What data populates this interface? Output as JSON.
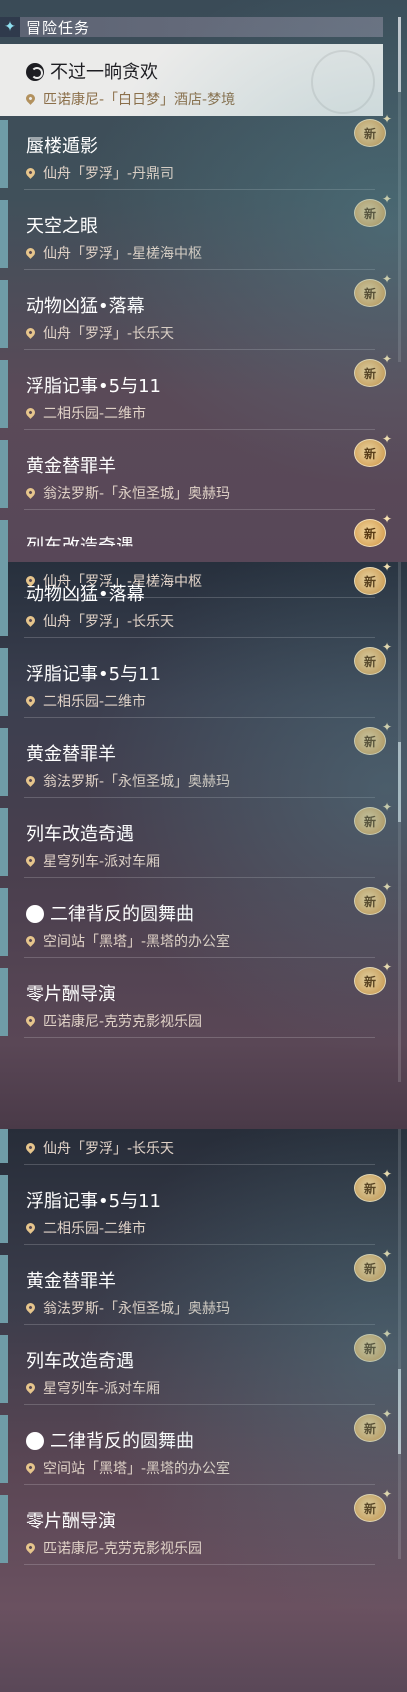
{
  "header": {
    "icon": "diamond-star-icon",
    "title": "冒险任务"
  },
  "badge_label": "新",
  "colors": {
    "accent_bar": "#6f9ca7",
    "badge": "#d9a65c",
    "selected_bg": "#ebebea",
    "location_text": "#e0d2c7"
  },
  "quests": [
    {
      "title": "不过一晌贪欢",
      "location": "匹诺康尼-「白日梦」酒店-梦境",
      "icon": "companion-quest-icon",
      "selected": true,
      "new": false
    },
    {
      "title": "蜃楼遁影",
      "location": "仙舟「罗浮」-丹鼎司",
      "new": true
    },
    {
      "title": "天空之眼",
      "location": "仙舟「罗浮」-星槎海中枢",
      "new": true
    },
    {
      "title": "动物凶猛•落幕",
      "location": "仙舟「罗浮」-长乐天",
      "new": true
    },
    {
      "title": "浮脂记事•5与11",
      "location": "二相乐园-二维市",
      "new": true
    },
    {
      "title": "黄金替罪羊",
      "location": "翁法罗斯-「永恒圣城」奥赫玛",
      "new": true
    },
    {
      "title": "列车改造奇遇",
      "location": "星穹列车-派对车厢",
      "new": true
    },
    {
      "title": "二律背反的圆舞曲",
      "location": "空间站「黑塔」-黑塔的办公室",
      "icon": "companion-quest-icon",
      "new": true
    },
    {
      "title": "零片酬导演",
      "location": "匹诺康尼-克劳克影视乐园",
      "new": false
    }
  ]
}
